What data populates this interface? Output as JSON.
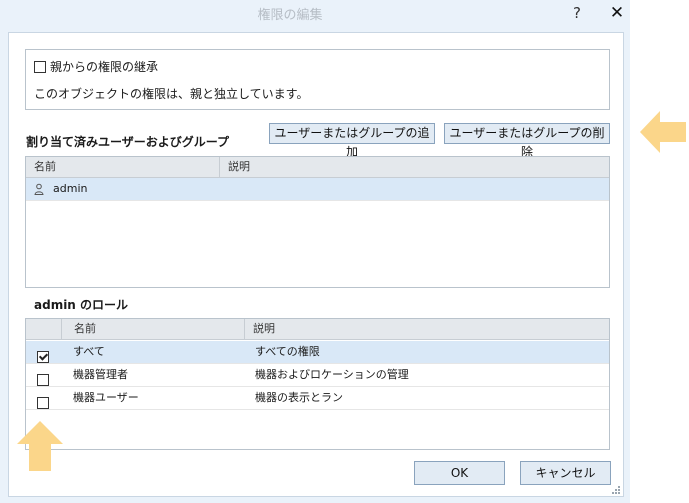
{
  "dialog": {
    "title": "権限の編集",
    "help": "?",
    "close": "✕"
  },
  "inherit": {
    "checkbox_label": "親からの権限の継承",
    "checked": false,
    "description": "このオブジェクトの権限は、親と独立しています。"
  },
  "assigned": {
    "section_label": "割り当て済みユーザーおよびグループ",
    "add_button": "ユーザーまたはグループの追加",
    "delete_button": "ユーザーまたはグループの削除",
    "columns": [
      "名前",
      "説明"
    ],
    "rows": [
      {
        "name": "admin",
        "description": "",
        "icon": "user-icon",
        "selected": true
      }
    ]
  },
  "roles": {
    "section_label": "admin のロール",
    "columns": [
      "",
      "名前",
      "説明"
    ],
    "rows": [
      {
        "checked": true,
        "name": "すべて",
        "description": "すべての権限",
        "selected": true
      },
      {
        "checked": false,
        "name": "機器管理者",
        "description": "機器およびロケーションの管理",
        "selected": false
      },
      {
        "checked": false,
        "name": "機器ユーザー",
        "description": "機器の表示とラン",
        "selected": false
      }
    ]
  },
  "footer": {
    "ok": "OK",
    "cancel": "キャンセル"
  },
  "colors": {
    "dialog_bg": "#eaf2fa",
    "selection": "#d9e8f7",
    "arrow_fill": "#fbd68a"
  }
}
